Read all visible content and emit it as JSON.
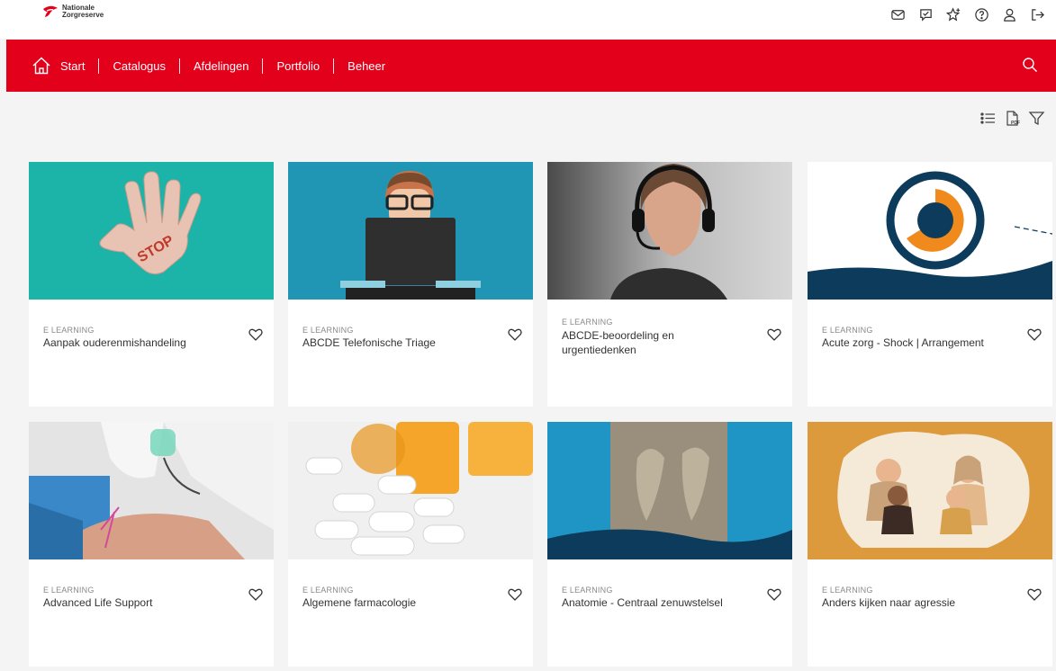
{
  "brand": {
    "line1": "Nationale",
    "line2": "Zorgreserve",
    "color": "#e3001b"
  },
  "top_icons": [
    "mail-icon",
    "chat-check-icon",
    "star-add-icon",
    "help-icon",
    "user-icon",
    "logout-icon"
  ],
  "nav": {
    "items": [
      "Start",
      "Catalogus",
      "Afdelingen",
      "Portfolio",
      "Beheer"
    ],
    "background": "#e3001b"
  },
  "toolbar": [
    "list-view-icon",
    "pdf-icon",
    "filter-icon"
  ],
  "cards": [
    {
      "category": "E LEARNING",
      "title": "Aanpak ouderenmishandeling",
      "image": "stop-hand",
      "image_text": "STOP"
    },
    {
      "category": "E LEARNING",
      "title": "ABCDE Telefonische Triage",
      "image": "person-at-computer"
    },
    {
      "category": "E LEARNING",
      "title": "ABCDE-beoordeling en urgentiedenken",
      "image": "woman-with-headset"
    },
    {
      "category": "E LEARNING",
      "title": "Acute zorg - Shock | Arrangement",
      "image": "circle-logo-wave"
    },
    {
      "category": "E LEARNING",
      "title": "Advanced Life Support",
      "image": "resuscitation-training"
    },
    {
      "category": "E LEARNING",
      "title": "Algemene farmacologie",
      "image": "pills"
    },
    {
      "category": "E LEARNING",
      "title": "Anatomie - Centraal zenuwstelsel",
      "image": "anatomy-sculpture"
    },
    {
      "category": "E LEARNING",
      "title": "Anders kijken naar agressie",
      "image": "people-illustration"
    }
  ]
}
